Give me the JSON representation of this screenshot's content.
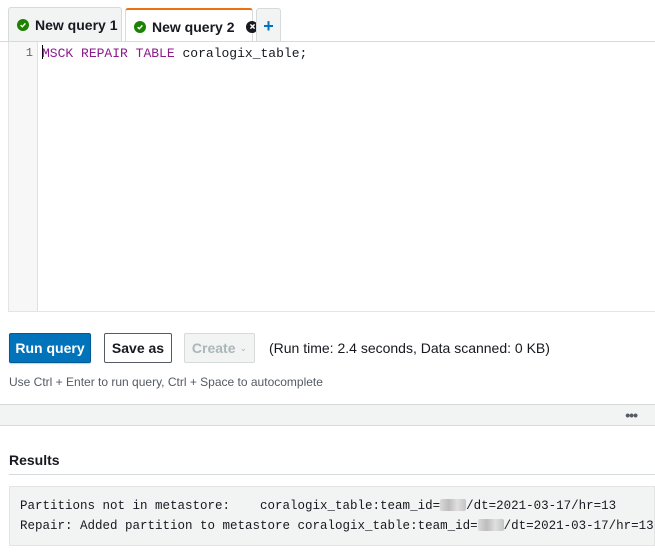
{
  "tabs": [
    {
      "label": "New query 1",
      "status_icon": "check-circle-icon",
      "active": false
    },
    {
      "label": "New query 2",
      "status_icon": "check-circle-icon",
      "active": true,
      "closable": true
    }
  ],
  "add_tab_icon": "plus-icon",
  "editor": {
    "line_number": "1",
    "keywords": [
      "MSCK",
      "REPAIR",
      "TABLE"
    ],
    "keyword_sep": " ",
    "identifier": "coralogix_table;"
  },
  "actions": {
    "run_label": "Run query",
    "save_label": "Save as",
    "create_label": "Create",
    "run_info": "(Run time: 2.4 seconds, Data scanned: 0 KB)"
  },
  "hint": "Use Ctrl + Enter to run query, Ctrl + Space to autocomplete",
  "results": {
    "title": "Results",
    "line1_prefix": "Partitions not in metastore:    coralogix_table:team_id=",
    "line1_suffix": "/dt=2021-03-17/hr=13",
    "line2_prefix": "Repair: Added partition to metastore coralogix_table:team_id=",
    "line2_suffix": "/dt=2021-03-17/hr=13"
  },
  "colors": {
    "primary": "#0073bb",
    "active_tab_accent": "#ec7211",
    "success": "#1d8102",
    "keyword": "#8b1a8b"
  }
}
